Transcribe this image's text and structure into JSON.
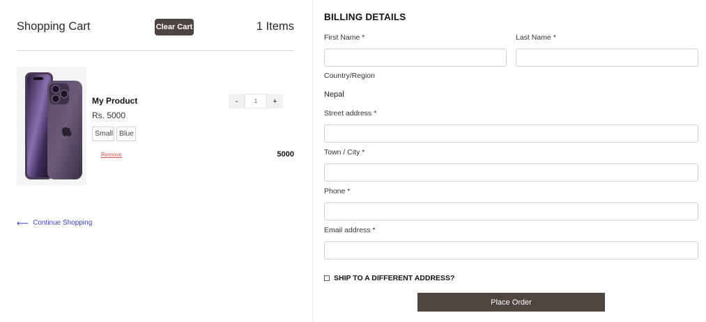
{
  "cart": {
    "title": "Shopping Cart",
    "clear_label": "Clear Cart",
    "items_count": "1 Items",
    "product": {
      "name": "My Product",
      "price": "Rs. 5000",
      "variants": [
        "Small",
        "Blue"
      ],
      "remove_label": "Remove",
      "qty_minus": "-",
      "qty_plus": "+",
      "qty_value": "1",
      "line_total": "5000"
    },
    "continue_arrow": "⟵",
    "continue_label": "Continue Shopping"
  },
  "billing": {
    "title": "BILLING DETAILS",
    "first_name_label": "First Name *",
    "last_name_label": "Last Name *",
    "country_label": "Country/Region",
    "country_value": "Nepal",
    "street_label": "Street address *",
    "town_label": "Town / City *",
    "phone_label": "Phone *",
    "email_label": "Email address *",
    "ship_label": "SHIP TO A DIFFERENT ADDRESS?",
    "place_order_label": "Place Order"
  },
  "colors": {
    "button_bg": "#4e4440",
    "link": "#3b41c8",
    "remove": "#d9534f"
  },
  "icons": {
    "continue": "arrow-left-icon",
    "product_image": "phone-product-image"
  }
}
